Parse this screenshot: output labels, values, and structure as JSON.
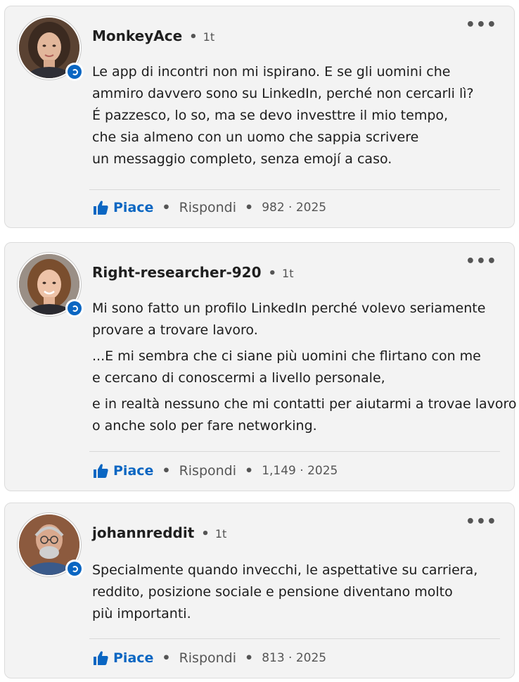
{
  "comments": [
    {
      "author": "MonkeyAce",
      "time": "1t",
      "lines": [
        [
          "Le app di incontri non mi ispirano. E se gli uomini che",
          "ammiro davvero sono su LinkedIn, perché non cercarli lì?",
          "É pazzesco, lo so, ma se devo investtre il mio tempo,",
          "che sia almeno con un uomo che sappia scrivere",
          "un messaggio completo, senza emojí a caso."
        ]
      ],
      "like_label": "Piace",
      "reply_label": "Rispondi",
      "meta": "982 · 2025"
    },
    {
      "author": "Right-researcher-920",
      "time": "1t",
      "lines": [
        [
          "Mi sono fatto un profilo LinkedIn perché volevo seriamente",
          "provare a trovare lavoro."
        ],
        [
          "...E mi sembra che ci siane più uomini che flirtano con me",
          "e cercano di conoscermi a livello personale,"
        ],
        [
          "e in realtà nessuno che mi contatti per aiutarmi a trovae lavoro",
          "o anche solo per fare networking."
        ]
      ],
      "like_label": "Piace",
      "reply_label": "Rispondi",
      "meta": "1,149 · 2025"
    },
    {
      "author": "johannreddit",
      "time": "1t",
      "lines": [
        [
          "Specialmente quando invecchi, le aspettative su carriera,",
          "reddito, posizione sociale e pensione diventano molto",
          "più importanti."
        ]
      ],
      "like_label": "Piace",
      "reply_label": "Rispondi",
      "meta": "813 · 2025"
    }
  ],
  "colors": {
    "accent": "#0a66c2",
    "card_bg": "#f3f3f3",
    "text": "#1c1c1c",
    "muted": "#555555"
  },
  "icons": {
    "more": "three-dots-icon",
    "like": "thumbs-up-icon",
    "badge": "open-to-work-badge-icon"
  },
  "more_glyph": "•••",
  "sep_glyph": "•"
}
